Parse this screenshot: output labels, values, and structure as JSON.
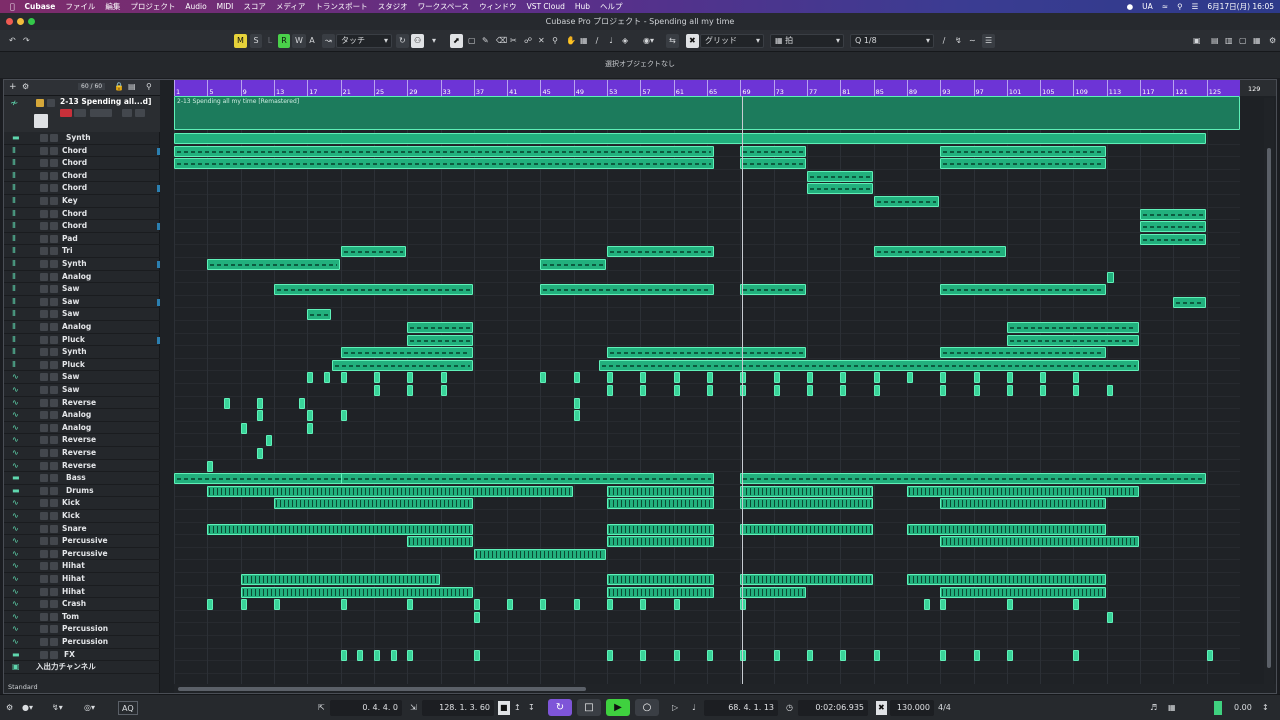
{
  "menubar": {
    "apple": "",
    "items": [
      "Cubase",
      "ファイル",
      "編集",
      "プロジェクト",
      "Audio",
      "MIDI",
      "スコア",
      "メディア",
      "トランスポート",
      "スタジオ",
      "ワークスペース",
      "ウィンドウ",
      "VST Cloud",
      "Hub",
      "ヘルプ"
    ],
    "input_source": "UA",
    "datetime": "6月17日(月) 16:05"
  },
  "window": {
    "title": "Cubase Pro プロジェクト - Spending all my time"
  },
  "toolbar": {
    "mute": "M",
    "solo": "S",
    "listen": "L",
    "read": "R",
    "write": "W",
    "automation": "A",
    "automation_mode": "タッチ",
    "snap_type": "グリッド",
    "snap_mode": "拍",
    "quantize": "1/8"
  },
  "info_line": {
    "text": "選択オブジェクトなし"
  },
  "track_header": {
    "count": "60 / 60"
  },
  "first_track": {
    "name": "2-13 Spending all...d]",
    "event_label": "2-13 Spending all my time [Remastered]"
  },
  "ruler": {
    "bars": [
      "1",
      "5",
      "9",
      "13",
      "17",
      "21",
      "25",
      "29",
      "33",
      "37",
      "41",
      "45",
      "49",
      "53",
      "57",
      "61",
      "65",
      "69",
      "73",
      "77",
      "81",
      "85",
      "89",
      "93",
      "97",
      "101",
      "105",
      "109",
      "113",
      "117",
      "121",
      "125"
    ],
    "end": "129"
  },
  "tracks": [
    {
      "name": "Synth",
      "type": "folder"
    },
    {
      "name": "Chord",
      "type": "instrument"
    },
    {
      "name": "Chord",
      "type": "instrument"
    },
    {
      "name": "Chord",
      "type": "instrument"
    },
    {
      "name": "Chord",
      "type": "instrument"
    },
    {
      "name": "Key",
      "type": "instrument"
    },
    {
      "name": "Chord",
      "type": "instrument"
    },
    {
      "name": "Chord",
      "type": "instrument"
    },
    {
      "name": "Pad",
      "type": "instrument"
    },
    {
      "name": "Tri",
      "type": "instrument"
    },
    {
      "name": "Synth",
      "type": "instrument"
    },
    {
      "name": "Analog",
      "type": "instrument"
    },
    {
      "name": "Saw",
      "type": "instrument"
    },
    {
      "name": "Saw",
      "type": "instrument"
    },
    {
      "name": "Saw",
      "type": "instrument"
    },
    {
      "name": "Analog",
      "type": "instrument"
    },
    {
      "name": "Pluck",
      "type": "instrument"
    },
    {
      "name": "Synth",
      "type": "instrument"
    },
    {
      "name": "Pluck",
      "type": "instrument"
    },
    {
      "name": "Saw",
      "type": "audio"
    },
    {
      "name": "Saw",
      "type": "audio"
    },
    {
      "name": "Reverse",
      "type": "audio"
    },
    {
      "name": "Analog",
      "type": "audio"
    },
    {
      "name": "Analog",
      "type": "audio"
    },
    {
      "name": "Reverse",
      "type": "audio"
    },
    {
      "name": "Reverse",
      "type": "audio"
    },
    {
      "name": "Reverse",
      "type": "audio"
    },
    {
      "name": "Bass",
      "type": "folder"
    },
    {
      "name": "Drums",
      "type": "folder"
    },
    {
      "name": "Kick",
      "type": "audio"
    },
    {
      "name": "Kick",
      "type": "audio"
    },
    {
      "name": "Snare",
      "type": "audio"
    },
    {
      "name": "Percussive",
      "type": "audio"
    },
    {
      "name": "Percussive",
      "type": "audio"
    },
    {
      "name": "Hihat",
      "type": "audio"
    },
    {
      "name": "Hihat",
      "type": "audio"
    },
    {
      "name": "Hihat",
      "type": "audio"
    },
    {
      "name": "Crash",
      "type": "audio"
    },
    {
      "name": "Tom",
      "type": "audio"
    },
    {
      "name": "Percussion",
      "type": "audio"
    },
    {
      "name": "Percussion",
      "type": "audio"
    },
    {
      "name": "FX",
      "type": "folder"
    },
    {
      "name": "入出力チャンネル",
      "type": "io"
    }
  ],
  "statusbar": {
    "layout": "Standard",
    "aq": "AQ",
    "left_locator": "0. 4. 4.   0",
    "right_locator": "128. 1. 3. 60",
    "position_bars": "68. 4. 1. 13",
    "position_time": "0:02:06.935",
    "tempo": "130.000",
    "signature": "4/4",
    "level": "0.00"
  },
  "colors": {
    "event": "#22b07d",
    "ruler": "#6d34d6",
    "menubar": "#5a2f8a"
  }
}
